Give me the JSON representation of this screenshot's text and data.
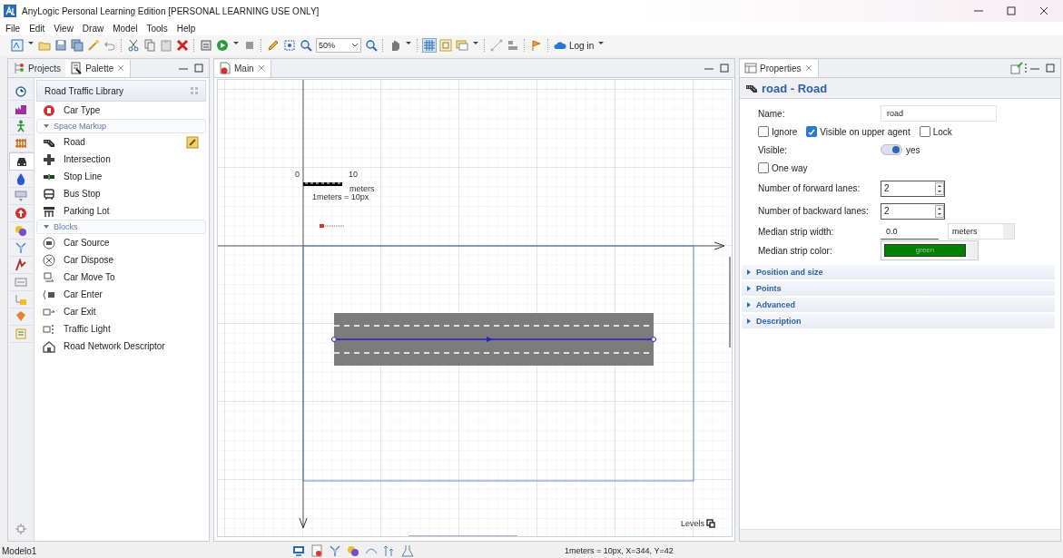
{
  "window": {
    "title": "AnyLogic Personal Learning Edition [PERSONAL LEARNING USE ONLY]"
  },
  "menu": [
    "File",
    "Edit",
    "View",
    "Draw",
    "Model",
    "Tools",
    "Help"
  ],
  "toolbar": {
    "zoom": "50%",
    "login": "Log in"
  },
  "left_panel": {
    "tabs": [
      {
        "label": "Projects",
        "selected": false
      },
      {
        "label": "Palette",
        "selected": true
      }
    ],
    "categories": [
      {
        "selected": false
      },
      {
        "selected": false
      },
      {
        "selected": false
      },
      {
        "selected": false
      },
      {
        "selected": true
      },
      {
        "selected": false
      },
      {
        "selected": false
      },
      {
        "selected": false
      },
      {
        "selected": false
      },
      {
        "selected": false
      },
      {
        "selected": false
      },
      {
        "selected": false
      },
      {
        "selected": false
      },
      {
        "selected": false
      },
      {
        "selected": false
      }
    ],
    "library": "Road Traffic Library",
    "groups": [
      {
        "items": [
          {
            "label": "Car Type",
            "selected": false
          }
        ]
      },
      {
        "title": "Space Markup",
        "expanded": true,
        "items": [
          {
            "label": "Road",
            "selected": true
          },
          {
            "label": "Intersection",
            "selected": false
          },
          {
            "label": "Stop Line",
            "selected": false
          },
          {
            "label": "Bus Stop",
            "selected": false
          },
          {
            "label": "Parking Lot",
            "selected": false
          }
        ]
      },
      {
        "title": "Blocks",
        "expanded": true,
        "items": [
          {
            "label": "Car Source",
            "selected": false
          },
          {
            "label": "Car Dispose",
            "selected": false
          },
          {
            "label": "Car Move To",
            "selected": false
          },
          {
            "label": "Car Enter",
            "selected": false
          },
          {
            "label": "Car Exit",
            "selected": false
          },
          {
            "label": "Traffic Light",
            "selected": false
          },
          {
            "label": "Road Network Descriptor",
            "selected": false
          }
        ]
      }
    ]
  },
  "editor": {
    "tabs": [
      {
        "label": "Main",
        "selected": true
      }
    ],
    "scale": {
      "start": "0",
      "end": "10",
      "unit": "meters",
      "ratio": "1meters = 10px"
    },
    "road": {
      "selected": true
    },
    "levels": "Levels"
  },
  "properties": {
    "tab": "Properties",
    "heading": "road - Road",
    "name": {
      "label": "Name:",
      "value": "road"
    },
    "checks": [
      {
        "label": "Ignore",
        "checked": false
      },
      {
        "label": "Visible on upper agent",
        "checked": true
      },
      {
        "label": "Lock",
        "checked": false
      }
    ],
    "visible": {
      "label": "Visible:",
      "on": true,
      "text": "yes"
    },
    "one_way": {
      "label": "One way",
      "checked": false
    },
    "forward_lanes": {
      "label": "Number of forward lanes:",
      "value": "2"
    },
    "backward_lanes": {
      "label": "Number of backward lanes:",
      "value": "2"
    },
    "median_width": {
      "label": "Median strip width:",
      "value": "0.0",
      "unit": "meters"
    },
    "median_color": {
      "label": "Median strip color:",
      "value": "green",
      "color": "#008000"
    },
    "sections": [
      {
        "title": "Position and size",
        "expanded": false
      },
      {
        "title": "Points",
        "expanded": false
      },
      {
        "title": "Advanced",
        "expanded": false
      },
      {
        "title": "Description",
        "expanded": false
      }
    ]
  },
  "status_bar": {
    "model": "Modelo1",
    "coords": "1meters = 10px, X=344, Y=42"
  }
}
